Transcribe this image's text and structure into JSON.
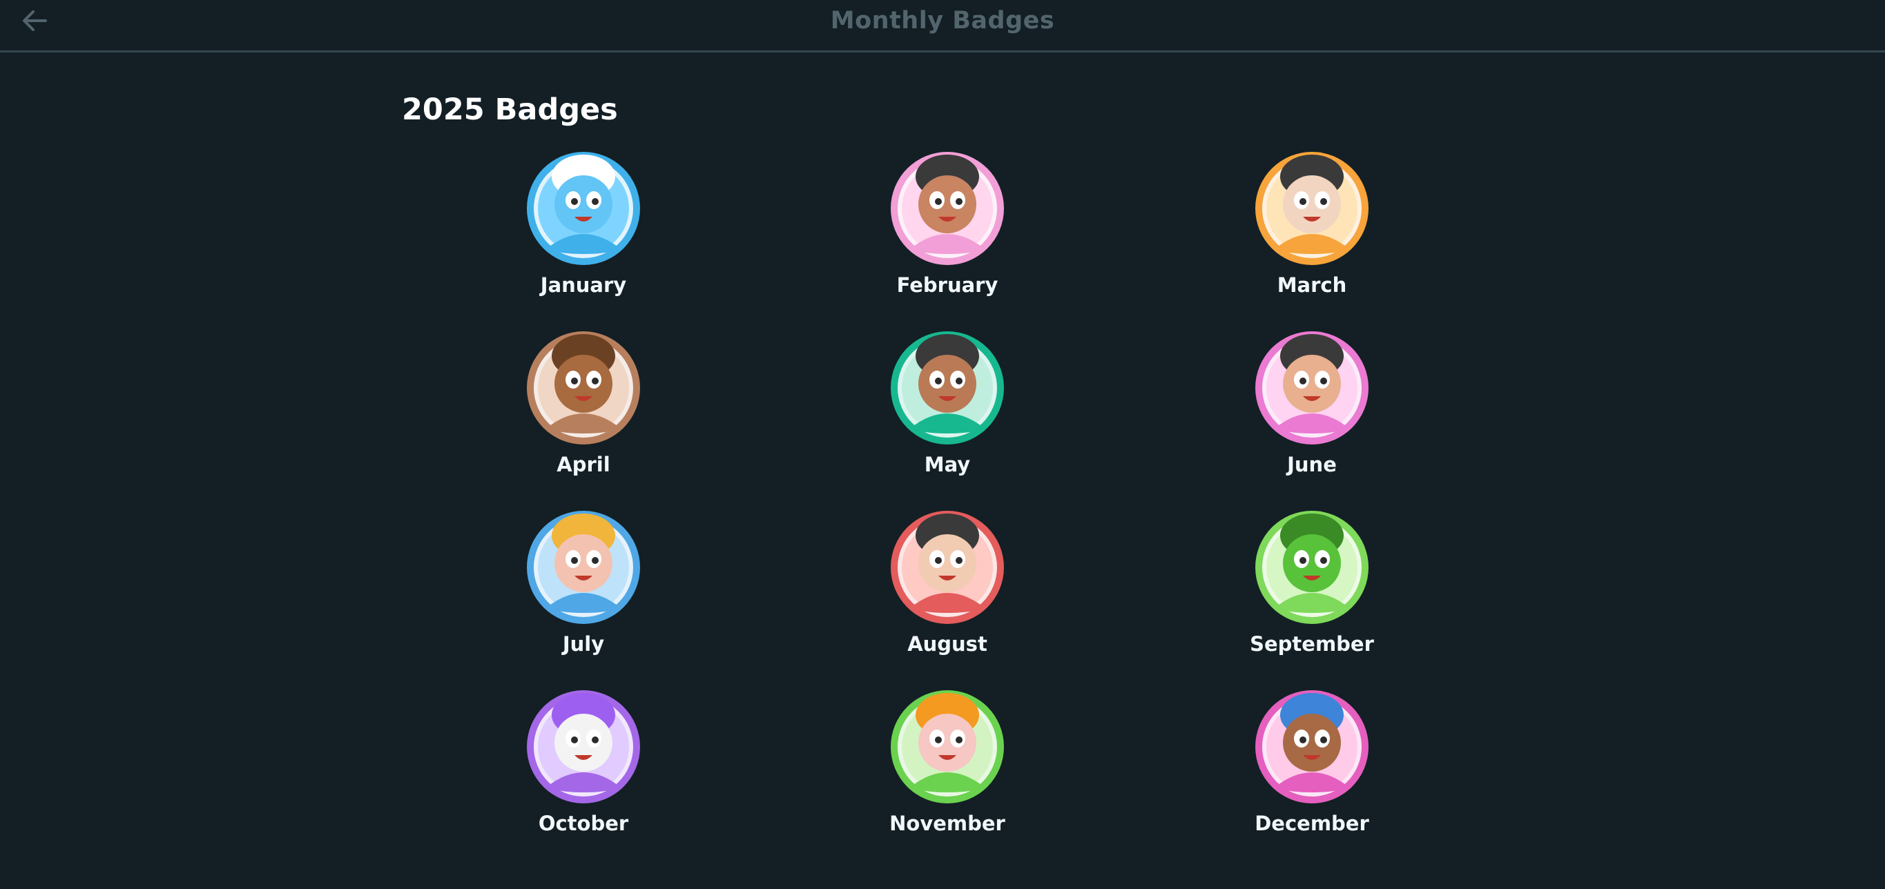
{
  "header": {
    "title": "Monthly Badges",
    "back_icon": "arrow-left-icon"
  },
  "section": {
    "title": "2025 Badges"
  },
  "badges": [
    {
      "month": "January",
      "ring": "#3fb0ea",
      "inner": "#7fd4ff",
      "character": "blue-owl",
      "skin": "#62c5f5",
      "hair": "#ffffff"
    },
    {
      "month": "February",
      "ring": "#f29fd7",
      "inner": "#ffd6ee",
      "character": "rose-dancer",
      "skin": "#c98462",
      "hair": "#3a3a3a"
    },
    {
      "month": "March",
      "ring": "#f6a43b",
      "inner": "#ffe4b8",
      "character": "sunglasses-agent",
      "skin": "#f2d5c1",
      "hair": "#3a3a3a"
    },
    {
      "month": "April",
      "ring": "#b87f5e",
      "inner": "#f0d6c4",
      "character": "party-bear",
      "skin": "#a86a3f",
      "hair": "#6b4124"
    },
    {
      "month": "May",
      "ring": "#17b890",
      "inner": "#bfeedf",
      "character": "flower-girl",
      "skin": "#b97a55",
      "hair": "#3a3a3a"
    },
    {
      "month": "June",
      "ring": "#ea7ad2",
      "inner": "#ffd3f2",
      "character": "popcorn-kid",
      "skin": "#e8b08f",
      "hair": "#3a3a3a"
    },
    {
      "month": "July",
      "ring": "#4fa7e6",
      "inner": "#bfe2fb",
      "character": "headband-flexer",
      "skin": "#f4c2b0",
      "hair": "#f0b53a"
    },
    {
      "month": "August",
      "ring": "#e45c5c",
      "inner": "#ffc9c4",
      "character": "scooter-rider",
      "skin": "#f2cbb3",
      "hair": "#3a3a3a"
    },
    {
      "month": "September",
      "ring": "#7fd95a",
      "inner": "#d6f6c4",
      "character": "glasses-owl",
      "skin": "#58c23a",
      "hair": "#3a8a25"
    },
    {
      "month": "October",
      "ring": "#a467e8",
      "inner": "#e1cbff",
      "character": "skull-wizard",
      "skin": "#f3f3f3",
      "hair": "#9d5ff0"
    },
    {
      "month": "November",
      "ring": "#6bd24f",
      "inner": "#d3f4c2",
      "character": "pilgrim-kid",
      "skin": "#f6c7c3",
      "hair": "#f49a21"
    },
    {
      "month": "December",
      "ring": "#e55fbf",
      "inner": "#ffcbe9",
      "character": "singer",
      "skin": "#a86a45",
      "hair": "#3e84d8"
    }
  ]
}
